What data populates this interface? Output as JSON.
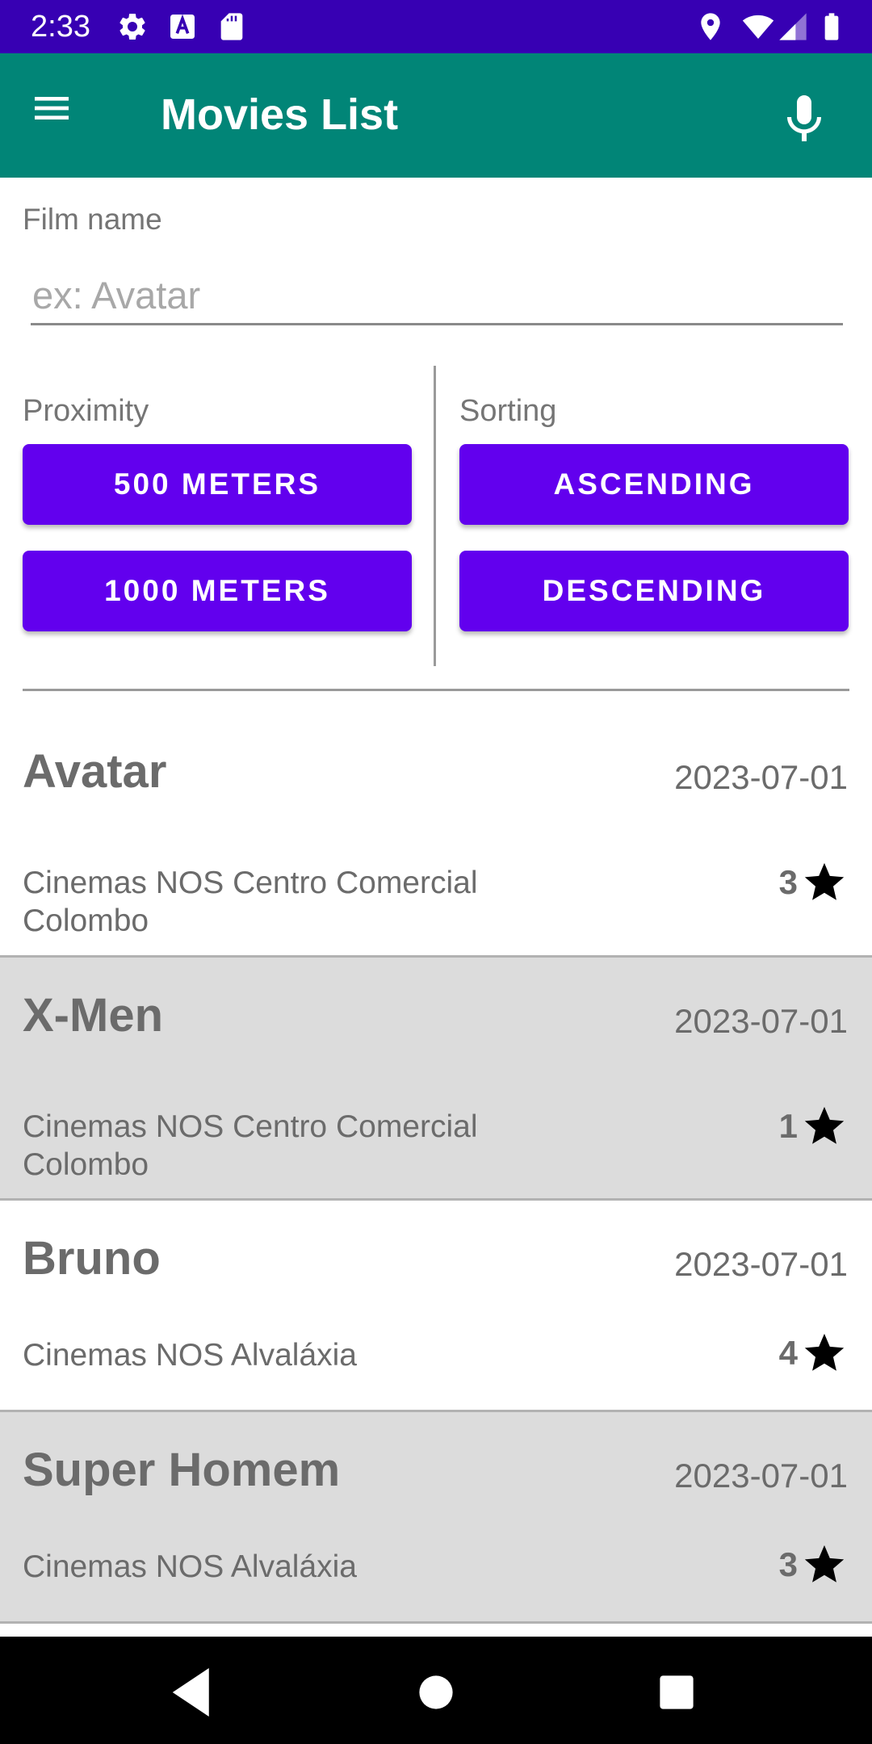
{
  "status_bar": {
    "time": "2:33",
    "icons": [
      "settings-icon",
      "keyboard-a-icon",
      "sd-card-icon",
      "location-icon",
      "wifi-icon",
      "signal-icon",
      "battery-icon"
    ]
  },
  "app_bar": {
    "title": "Movies List",
    "menu_icon": "menu-icon",
    "mic_icon": "microphone-icon"
  },
  "form": {
    "film_name_label": "Film name",
    "film_name_placeholder": "ex: Avatar",
    "film_name_value": "",
    "proximity_label": "Proximity",
    "sorting_label": "Sorting",
    "buttons": {
      "meters_500": "500 METERS",
      "meters_1000": "1000 METERS",
      "ascending": "ASCENDING",
      "descending": "DESCENDING"
    }
  },
  "movies": [
    {
      "title": "Avatar",
      "date": "2023-07-01",
      "cinema": "Cinemas NOS Centro Comercial Colombo",
      "rating": "3"
    },
    {
      "title": "X-Men",
      "date": "2023-07-01",
      "cinema": "Cinemas NOS Centro Comercial Colombo",
      "rating": "1"
    },
    {
      "title": "Bruno",
      "date": "2023-07-01",
      "cinema": "Cinemas NOS Alvaláxia",
      "rating": "4"
    },
    {
      "title": "Super Homem",
      "date": "2023-07-01",
      "cinema": "Cinemas NOS Alvaláxia",
      "rating": "3"
    }
  ],
  "colors": {
    "status_bar": "#3700b3",
    "app_bar": "#018577",
    "button": "#6200ee",
    "alt_row": "#dcdcdc"
  }
}
